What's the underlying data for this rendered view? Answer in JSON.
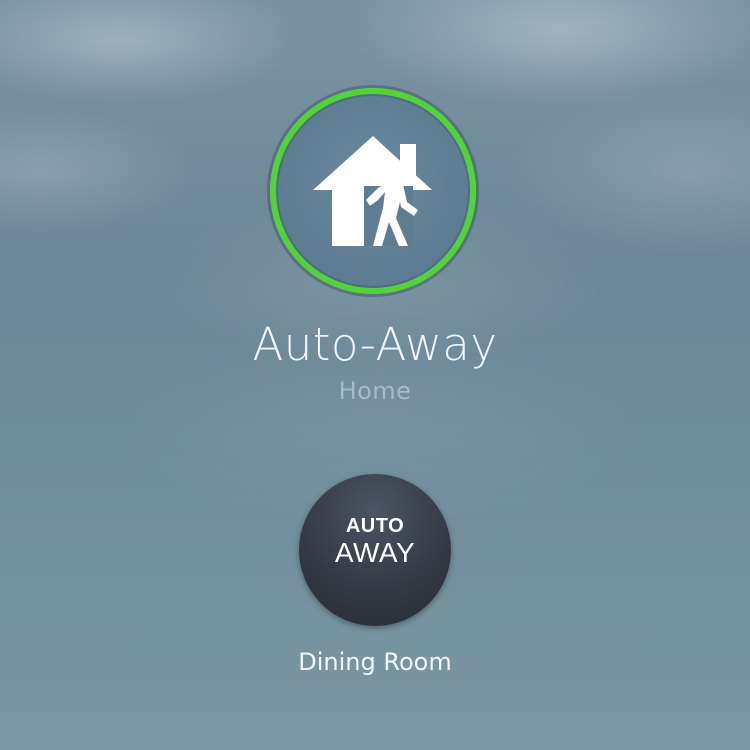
{
  "status": {
    "icon": "house-walking-person-icon",
    "ring_color": "#53d33a",
    "title": "Auto-Away",
    "subtitle": "Home"
  },
  "thermostat": {
    "line1": "AUTO",
    "line2": "AWAY",
    "label": "Dining Room"
  }
}
